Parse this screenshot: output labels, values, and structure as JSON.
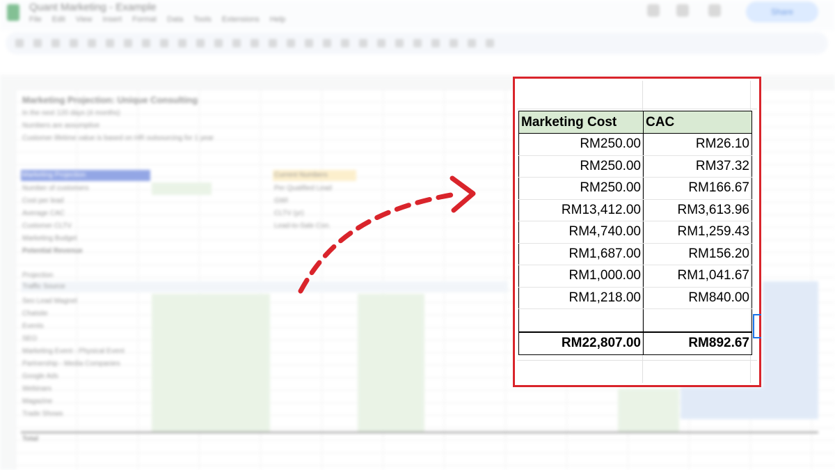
{
  "window": {
    "doc_title": "Quant Marketing - Example",
    "menus": [
      "File",
      "Edit",
      "View",
      "Insert",
      "Format",
      "Data",
      "Tools",
      "Extensions",
      "Help"
    ],
    "share_label": "Share"
  },
  "background_sheet": {
    "title": "Marketing Projection: Unique Consulting",
    "notes": [
      "In the next 120 days (4 months)",
      "Numbers are assumptive",
      "Customer lifetime value is based on HR outsourcing for 1 year"
    ],
    "projection_header": "Marketing Projection",
    "projection_rows": [
      "Number of customers",
      "Cost per lead",
      "Average CAC",
      "Customer CLTV",
      "Marketing Budget",
      "Potential Revenue"
    ],
    "current_header": "Current Numbers",
    "current_rows": [
      "Per Qualified Lead",
      "GWI",
      "CLTV (yr)",
      "Lead-to-Sale Con."
    ],
    "section_label": "Projection",
    "traffic_header": "Traffic Source",
    "traffic_rows": [
      "Seo Lead Magnet",
      "Chatsite",
      "Events",
      "SEO",
      "Marketing Event - Physical Event",
      "Partnership - Media Companies",
      "Google Ads",
      "Webinars",
      "Magazine",
      "Trade Shows"
    ],
    "total_label": "Total"
  },
  "focus_table": {
    "headers": [
      "Marketing Cost",
      "CAC"
    ],
    "rows": [
      [
        "RM250.00",
        "RM26.10"
      ],
      [
        "RM250.00",
        "RM37.32"
      ],
      [
        "RM250.00",
        "RM166.67"
      ],
      [
        "RM13,412.00",
        "RM3,613.96"
      ],
      [
        "RM4,740.00",
        "RM1,259.43"
      ],
      [
        "RM1,687.00",
        "RM156.20"
      ],
      [
        "RM1,000.00",
        "RM1,041.67"
      ],
      [
        "RM1,218.00",
        "RM840.00"
      ],
      [
        "",
        ""
      ]
    ],
    "total": [
      "RM22,807.00",
      "RM892.67"
    ]
  },
  "colors": {
    "highlight_border": "#d9242b",
    "header_fill": "#d9ead3",
    "arrow": "#d9242b",
    "selection": "#1a73e8"
  }
}
